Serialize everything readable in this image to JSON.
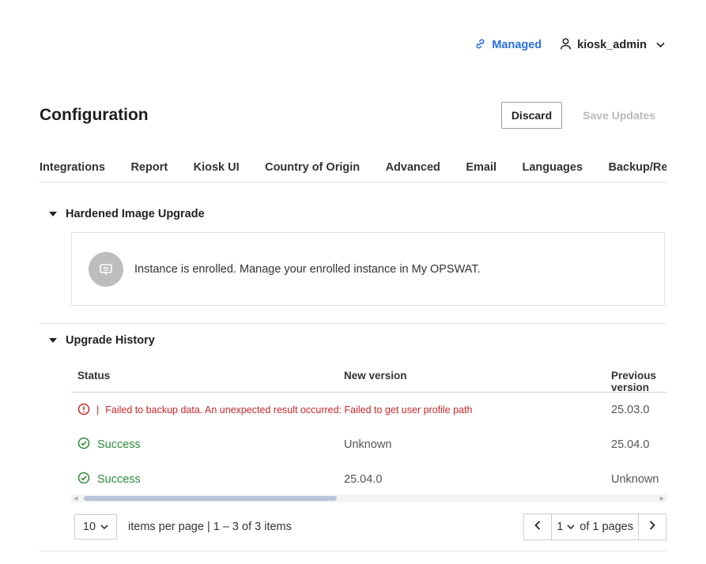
{
  "topbar": {
    "managed_label": "Managed",
    "username": "kiosk_admin"
  },
  "header": {
    "title": "Configuration",
    "discard_label": "Discard",
    "save_label": "Save Updates"
  },
  "tabs": [
    {
      "label": "Integrations"
    },
    {
      "label": "Report"
    },
    {
      "label": "Kiosk UI"
    },
    {
      "label": "Country of Origin"
    },
    {
      "label": "Advanced"
    },
    {
      "label": "Email"
    },
    {
      "label": "Languages"
    },
    {
      "label": "Backup/Restore"
    }
  ],
  "hardened": {
    "title": "Hardened Image Upgrade",
    "message": "Instance is enrolled. Manage your enrolled instance in My OPSWAT."
  },
  "history": {
    "title": "Upgrade History",
    "columns": [
      "Status",
      "New version",
      "Previous version"
    ],
    "rows": [
      {
        "status": "Failed to backup data. An unexpected result occurred: Failed to get user profile path",
        "status_type": "error",
        "new_version": "",
        "previous_version": "25.03.0"
      },
      {
        "status": "Success",
        "status_type": "success",
        "new_version": "Unknown",
        "previous_version": "25.04.0"
      },
      {
        "status": "Success",
        "status_type": "success",
        "new_version": "25.04.0",
        "previous_version": "Unknown"
      }
    ]
  },
  "pagination": {
    "per_page": "10",
    "items_label": "items per page | 1 – 3 of 3 items",
    "current_page": "1",
    "of_pages": "of 1 pages"
  },
  "colors": {
    "accent": "#2a6fdb",
    "error": "#c62828",
    "success": "#2e8b3a"
  },
  "icons": {
    "managed": "link-icon",
    "user": "user-icon",
    "enrolled": "server-icon",
    "error": "error-circle-icon",
    "success": "check-circle-icon"
  }
}
